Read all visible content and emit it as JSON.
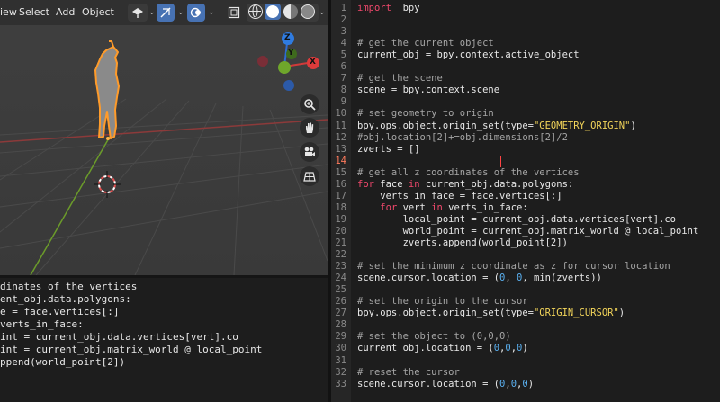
{
  "viewport": {
    "menu": [
      "View",
      "Select",
      "Add",
      "Object"
    ],
    "menu_visible": [
      "iew",
      "Select",
      "Add",
      "Object"
    ],
    "gizmo": {
      "z": "Z",
      "y": "Y",
      "x": "X"
    },
    "icons": [
      "zoom-icon",
      "hand-icon",
      "camera-icon",
      "grid-icon"
    ]
  },
  "console": {
    "lines": [
      "dinates of the vertices",
      "ent_obj.data.polygons:",
      "e = face.vertices[:]",
      "verts_in_face:",
      "int = current_obj.data.vertices[vert].co",
      "int = current_obj.matrix_world @ local_point",
      "ppend(world_point[2])",
      ""
    ]
  },
  "editor": {
    "current_line": 14,
    "lines": [
      [
        [
          "kw",
          "import"
        ],
        [
          "",
          "  bpy"
        ]
      ],
      [],
      [],
      [
        [
          "cm",
          "# get the current object"
        ]
      ],
      [
        [
          "",
          "current_obj = bpy.context.active_object"
        ]
      ],
      [],
      [
        [
          "cm",
          "# get the scene"
        ]
      ],
      [
        [
          "",
          "scene = bpy.context.scene"
        ]
      ],
      [],
      [
        [
          "cm",
          "# set geometry to origin"
        ]
      ],
      [
        [
          "",
          "bpy.ops.object.origin_set(type="
        ],
        [
          "st",
          "\"GEOMETRY_ORIGIN\""
        ],
        [
          "",
          ")"
        ]
      ],
      [
        [
          "cm",
          "#obj.location[2]+=obj.dimensions[2]/2"
        ]
      ],
      [
        [
          "",
          "zverts = []"
        ]
      ],
      [],
      [
        [
          "cm",
          "# get all z coordinates of the vertices"
        ]
      ],
      [
        [
          "kw",
          "for"
        ],
        [
          "",
          " face "
        ],
        [
          "kw",
          "in"
        ],
        [
          "",
          " current_obj.data.polygons:"
        ]
      ],
      [
        [
          "",
          "    verts_in_face = face.vertices[:]"
        ]
      ],
      [
        [
          "",
          "    "
        ],
        [
          "kw",
          "for"
        ],
        [
          "",
          " vert "
        ],
        [
          "kw",
          "in"
        ],
        [
          "",
          " verts_in_face:"
        ]
      ],
      [
        [
          "",
          "        local_point = current_obj.data.vertices[vert].co"
        ]
      ],
      [
        [
          "",
          "        world_point = current_obj.matrix_world @ local_point"
        ]
      ],
      [
        [
          "",
          "        zverts.append(world_point[2])"
        ]
      ],
      [],
      [
        [
          "cm",
          "# set the minimum z coordinate as z for cursor location"
        ]
      ],
      [
        [
          "",
          "scene.cursor.location = ("
        ],
        [
          "nu",
          "0"
        ],
        [
          "",
          ", "
        ],
        [
          "nu",
          "0"
        ],
        [
          "",
          ", min(zverts))"
        ]
      ],
      [],
      [
        [
          "cm",
          "# set the origin to the cursor"
        ]
      ],
      [
        [
          "",
          "bpy.ops.object.origin_set(type="
        ],
        [
          "st",
          "\"ORIGIN_CURSOR\""
        ],
        [
          "",
          ")"
        ]
      ],
      [],
      [
        [
          "cm",
          "# set the object to (0,0,0)"
        ]
      ],
      [
        [
          "",
          "current_obj.location = ("
        ],
        [
          "nu",
          "0"
        ],
        [
          "",
          ","
        ],
        [
          "nu",
          "0"
        ],
        [
          "",
          ","
        ],
        [
          "nu",
          "0"
        ],
        [
          "",
          ")"
        ]
      ],
      [],
      [
        [
          "cm",
          "# reset the cursor"
        ]
      ],
      [
        [
          "",
          "scene.cursor.location = ("
        ],
        [
          "nu",
          "0"
        ],
        [
          "",
          ","
        ],
        [
          "nu",
          "0"
        ],
        [
          "",
          ","
        ],
        [
          "nu",
          "0"
        ],
        [
          "",
          ")"
        ]
      ]
    ]
  },
  "colors": {
    "keyword": "#f0486c",
    "comment": "#a6a6a6",
    "string": "#f3d55a",
    "number": "#5ab0f0",
    "selection": "#ffa033",
    "accent": "#4772b3"
  }
}
